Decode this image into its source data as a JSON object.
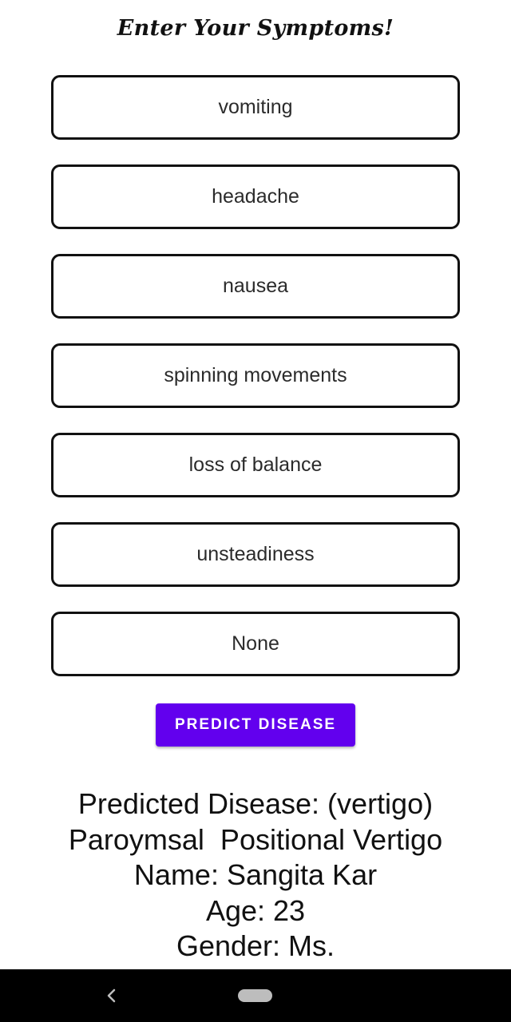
{
  "header": {
    "title": "Enter Your Symptoms!"
  },
  "symptoms": [
    "vomiting",
    "headache",
    "nausea",
    "spinning movements",
    "loss of balance",
    "unsteadiness",
    "None"
  ],
  "actions": {
    "predict_label": "PREDICT DISEASE"
  },
  "result": {
    "line1": "Predicted Disease: (vertigo)",
    "line2": "Paroymsal  Positional Vertigo",
    "line3": "Name: Sangita Kar",
    "line4": "Age: 23",
    "line5": "Gender: Ms."
  },
  "colors": {
    "accent": "#6200ee",
    "nav_bar": "#000000",
    "field_border": "#111111"
  },
  "nav": {
    "back_icon": "chevron-left-icon",
    "home_icon": "home-pill-icon"
  }
}
